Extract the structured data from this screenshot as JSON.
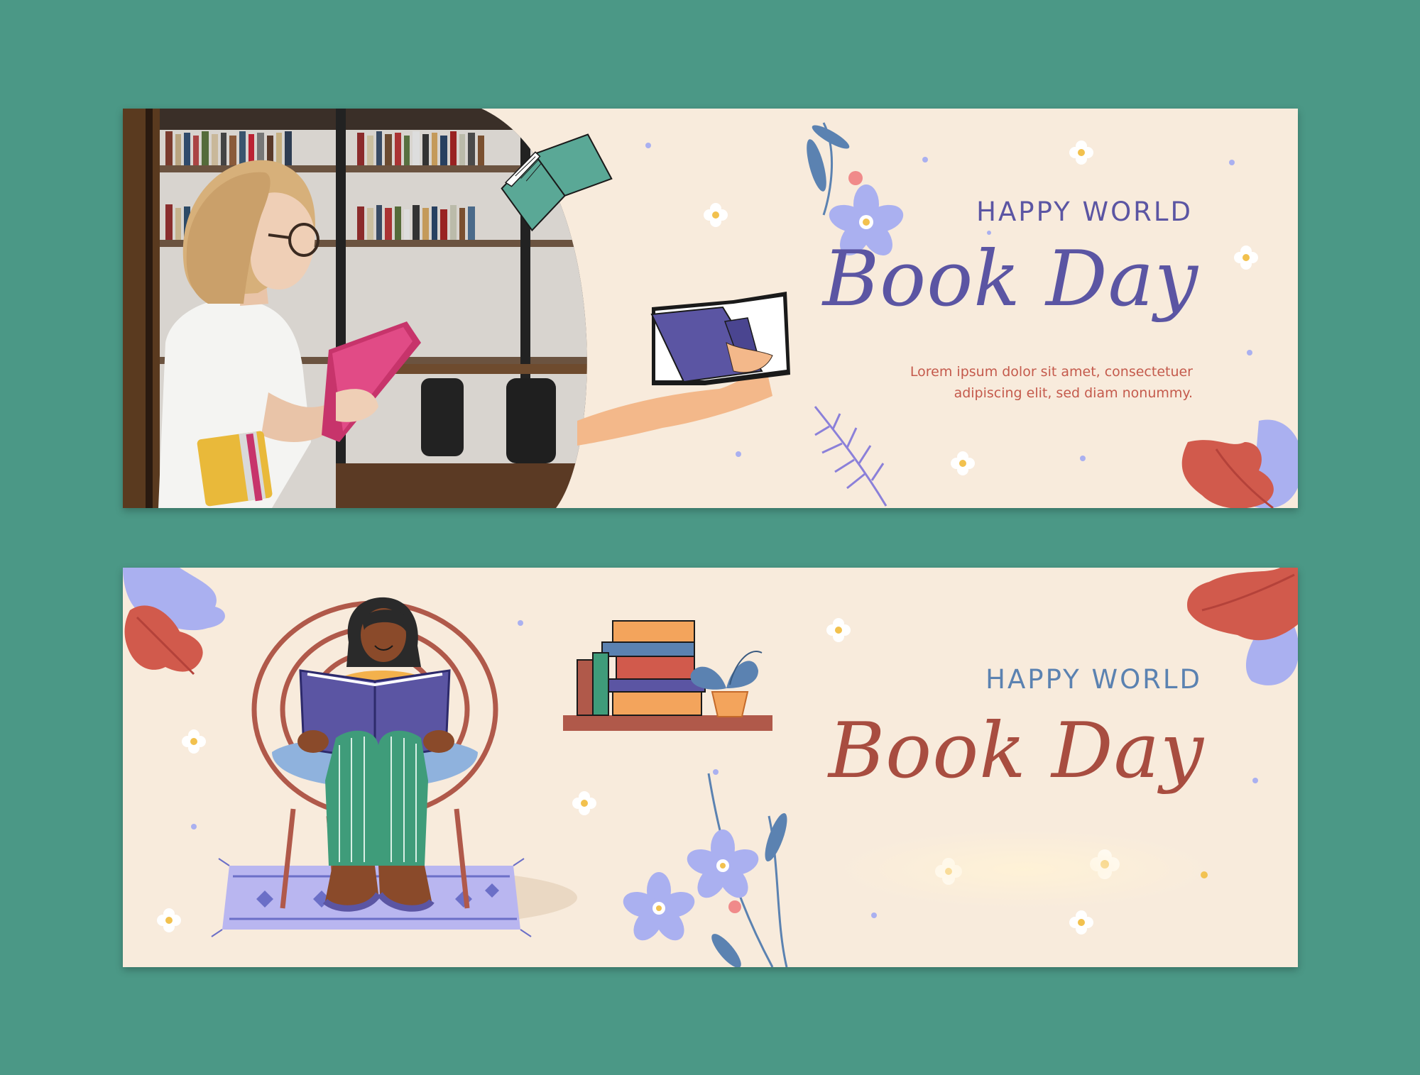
{
  "banners": [
    {
      "eyebrow": "HAPPY WORLD",
      "headline": "Book Day",
      "body": [
        "Lorem ipsum dolor sit amet, consectetuer",
        "adipiscing elit, sed diam nonummy."
      ]
    },
    {
      "eyebrow": "HAPPY WORLD",
      "headline": "Book Day"
    }
  ],
  "colors": {
    "background": "#4b9886",
    "banner": "#f8ebdc",
    "indigo": "#5b55a3",
    "coral": "#c45a4c",
    "rust": "#a84d40",
    "steel_blue": "#5b82b1",
    "lavender": "#aab0f0",
    "teal_book": "#5aa896"
  },
  "icons": [
    "flying-book-icon",
    "held-book-icon",
    "flower-icon",
    "leaf-icon",
    "daisy-icon",
    "book-stack-icon",
    "plant-icon",
    "rug-icon",
    "chair-icon"
  ]
}
